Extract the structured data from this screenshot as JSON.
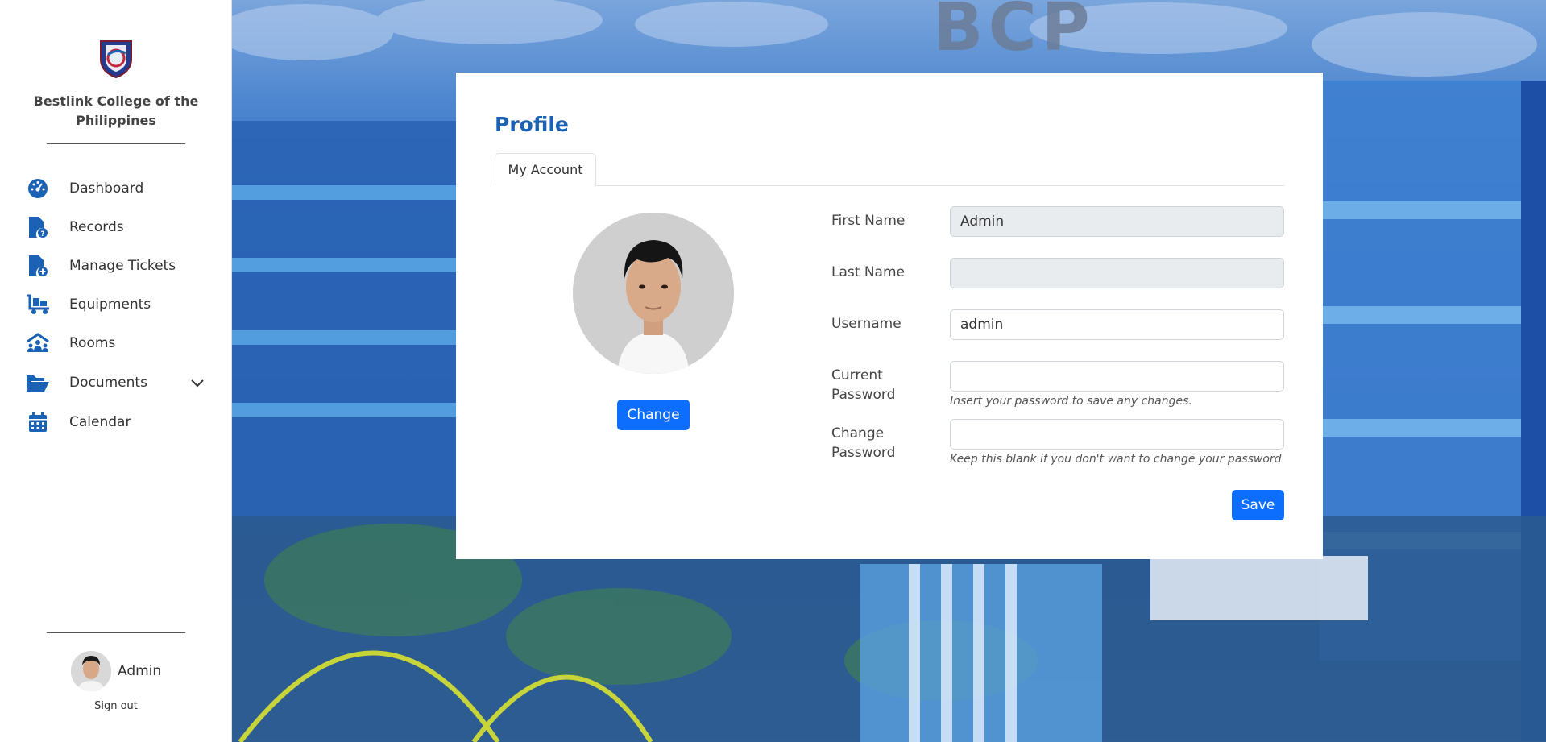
{
  "sidebar": {
    "school_name": "Bestlink College of the Philippines",
    "logo_icon": "school-crest-icon",
    "items": [
      {
        "label": "Dashboard",
        "icon": "dashboard-gauge-icon"
      },
      {
        "label": "Records",
        "icon": "file-question-icon"
      },
      {
        "label": "Manage Tickets",
        "icon": "file-plus-icon"
      },
      {
        "label": "Equipments",
        "icon": "dolly-cart-icon"
      },
      {
        "label": "Rooms",
        "icon": "people-roof-icon"
      },
      {
        "label": "Documents",
        "icon": "folder-open-icon",
        "has_dropdown": true
      },
      {
        "label": "Calendar",
        "icon": "calendar-icon"
      }
    ],
    "user": {
      "name": "Admin",
      "signout_label": "Sign out"
    }
  },
  "profile": {
    "title": "Profile",
    "tab": "My Account",
    "change_photo_label": "Change",
    "fields": {
      "first_name": {
        "label": "First Name",
        "value": "Admin"
      },
      "last_name": {
        "label": "Last Name",
        "value": ""
      },
      "username": {
        "label": "Username",
        "value": "admin"
      },
      "current_password": {
        "label_line1": "Current",
        "label_line2": "Password",
        "value": "",
        "help": "Insert your password to save any changes."
      },
      "change_password": {
        "label_line1": "Change",
        "label_line2": "Password",
        "value": "",
        "help": "Keep this blank if you don't want to change your password"
      }
    },
    "save_label": "Save"
  },
  "colors": {
    "accent": "#1b62b5",
    "button": "#0d6efd",
    "icon": "#1b62b5"
  }
}
